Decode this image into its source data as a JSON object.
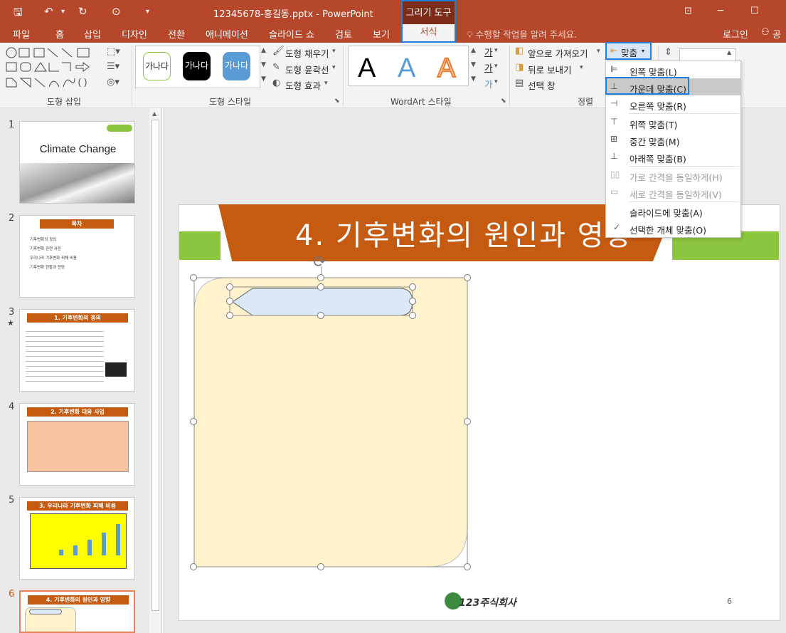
{
  "titlebar": {
    "title": "12345678-홍길동.pptx - PowerPoint",
    "context_group": "그리기 도구",
    "qat": {
      "save": "🖫",
      "undo": "↶",
      "undo_drop": "▾",
      "redo": "↻",
      "present": "⊙",
      "more": "▾"
    },
    "win_controls": {
      "restore_ribbon": "⊡",
      "minimize": "─",
      "maximize": "☐"
    }
  },
  "tabs": [
    {
      "label": "파일"
    },
    {
      "label": "홈"
    },
    {
      "label": "삽입"
    },
    {
      "label": "디자인"
    },
    {
      "label": "전환"
    },
    {
      "label": "애니메이션"
    },
    {
      "label": "슬라이드 쇼"
    },
    {
      "label": "검토"
    },
    {
      "label": "보기"
    }
  ],
  "tab_format": "서식",
  "tellme": "수행할 작업을 알려 주세요.",
  "account": {
    "login": "로그인",
    "share": "공유"
  },
  "groups": {
    "insert_shapes": "도형 삽입",
    "shape_styles": "도형 스타일",
    "wordart_styles": "WordArt 스타일",
    "arrange": "정렬"
  },
  "shape_style_samples": [
    {
      "text": "가나다"
    },
    {
      "text": "가나다"
    },
    {
      "text": "가나다"
    }
  ],
  "shape_fill": "도형 채우기",
  "shape_outline": "도형 윤곽선",
  "shape_effects": "도형 효과",
  "wordart": {
    "letters": [
      "A",
      "A",
      "A"
    ],
    "text_fill_icon": "가",
    "text_outline_icon": "가",
    "text_effects_icon": "가"
  },
  "arrange": {
    "bring_forward": "앞으로 가져오기",
    "send_backward": "뒤로 보내기",
    "selection_pane": "선택 창",
    "align": "맞춤"
  },
  "align_menu": [
    {
      "icon": "align-left-icon",
      "label": "왼쪽 맞춤(L)",
      "disabled": false
    },
    {
      "icon": "align-center-icon",
      "label": "가운데 맞춤(C)",
      "disabled": false
    },
    {
      "icon": "align-right-icon",
      "label": "오른쪽 맞춤(R)",
      "disabled": false
    },
    {
      "icon": "align-top-icon",
      "label": "위쪽 맞춤(T)",
      "disabled": false
    },
    {
      "icon": "align-middle-icon",
      "label": "중간 맞춤(M)",
      "disabled": false
    },
    {
      "icon": "align-bottom-icon",
      "label": "아래쪽 맞춤(B)",
      "disabled": false
    },
    {
      "icon": "distribute-horizontal-icon",
      "label": "가로 간격을 동일하게(H)",
      "disabled": true
    },
    {
      "icon": "distribute-vertical-icon",
      "label": "세로 간격을 동일하게(V)",
      "disabled": true
    },
    {
      "icon": "",
      "label": "슬라이드에 맞춤(A)",
      "disabled": false
    },
    {
      "icon": "check-icon",
      "label": "선택한 개체 맞춤(O)",
      "disabled": false
    }
  ],
  "thumbnails": [
    {
      "num": "1",
      "title": "Climate Change"
    },
    {
      "num": "2",
      "title": "목차",
      "items": [
        "기후변화의 정의",
        "기후변화 관련 사진",
        "우리나라 기후변화 피해 비용",
        "기후변화 현황과 전망"
      ]
    },
    {
      "num": "3",
      "title": "1. 기후변화의 정의",
      "star": "★"
    },
    {
      "num": "4",
      "title": "2. 기후변화 대응 사업"
    },
    {
      "num": "5",
      "title": "3. 우리나라 기후변화 피해 비용"
    },
    {
      "num": "6",
      "title": "4. 기후변화의 원인과 영향"
    }
  ],
  "slide": {
    "title": "4. 기후변화의 원인과 영향",
    "page_number": "6",
    "logo_text": "123주식회사"
  },
  "colors": {
    "accent": "#b7472a",
    "title_orange": "#c55a11",
    "green": "#8cc63f",
    "shape_fill": "#fff2cc",
    "small_shape_fill": "#dae8f8",
    "highlight_blue": "#1e7fe0"
  }
}
